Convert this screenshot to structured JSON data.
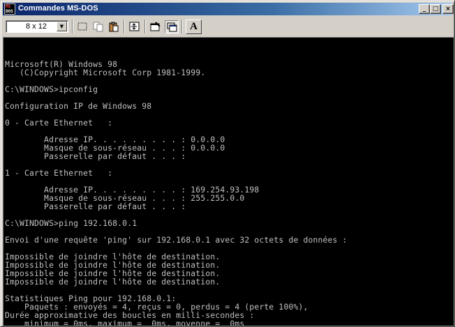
{
  "window": {
    "title": "Commandes MS-DOS",
    "icon_text_top": "MS",
    "icon_text_bottom": "DOS",
    "controls": {
      "minimize": "_",
      "maximize": "□",
      "close": "×"
    }
  },
  "toolbar": {
    "font_size_value": "8 x 12",
    "dropdown_arrow": "▼",
    "font_button_label": "A",
    "buttons": [
      "mark-icon",
      "copy-icon",
      "paste-icon",
      "fullscreen-icon",
      "properties-icon",
      "background-icon",
      "font-icon"
    ]
  },
  "console": {
    "lines": [
      "",
      "Microsoft(R) Windows 98",
      "   (C)Copyright Microsoft Corp 1981-1999.",
      "",
      "C:\\WINDOWS>ipconfig",
      "",
      "Configuration IP de Windows 98",
      "",
      "0 - Carte Ethernet   :",
      "",
      "        Adresse IP. . . . . . . . . : 0.0.0.0",
      "        Masque de sous-réseau . . . : 0.0.0.0",
      "        Passerelle par défaut . . . :",
      "",
      "1 - Carte Ethernet   :",
      "",
      "        Adresse IP. . . . . . . . . : 169.254.93.198",
      "        Masque de sous-réseau . . . : 255.255.0.0",
      "        Passerelle par défaut . . . :",
      "",
      "C:\\WINDOWS>ping 192.168.0.1",
      "",
      "Envoi d'une requête 'ping' sur 192.168.0.1 avec 32 octets de données :",
      "",
      "Impossible de joindre l'hôte de destination.",
      "Impossible de joindre l'hôte de destination.",
      "Impossible de joindre l'hôte de destination.",
      "Impossible de joindre l'hôte de destination.",
      "",
      "Statistiques Ping pour 192.168.0.1:",
      "    Paquets : envoyés = 4, reçus = 0, perdus = 4 (perte 100%),",
      "Durée approximative des boucles en milli-secondes :",
      "    minimum = 0ms, maximum =  0ms, moyenne =  0ms"
    ]
  },
  "colors": {
    "title_gradient_start": "#0a246a",
    "title_gradient_end": "#a6caf0",
    "console_bg": "#000000",
    "console_text": "#c0c0c0",
    "chrome": "#d4d0c8"
  }
}
